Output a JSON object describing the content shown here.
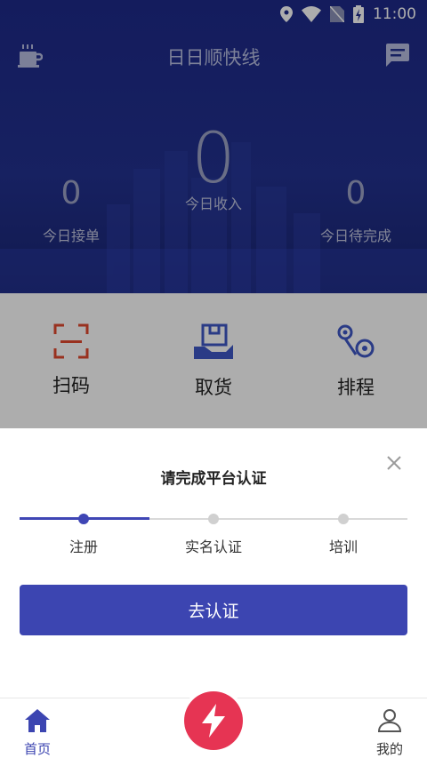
{
  "status_bar": {
    "time": "11:00"
  },
  "header": {
    "title": "日日顺快线"
  },
  "stats": {
    "main_value": "0",
    "items": [
      {
        "value": "0",
        "label": "今日接单"
      },
      {
        "value": "",
        "label": "今日收入"
      },
      {
        "value": "0",
        "label": "今日待完成"
      }
    ]
  },
  "actions": [
    {
      "label": "扫码",
      "icon": "scan-icon"
    },
    {
      "label": "取货",
      "icon": "pickup-icon"
    },
    {
      "label": "排程",
      "icon": "schedule-route-icon"
    }
  ],
  "sheet": {
    "title": "请完成平台认证",
    "steps": [
      {
        "label": "注册",
        "done": true
      },
      {
        "label": "实名认证",
        "done": false
      },
      {
        "label": "培训",
        "done": false
      }
    ],
    "button_label": "去认证"
  },
  "bottom_nav": {
    "home_label": "首页",
    "mine_label": "我的"
  },
  "colors": {
    "primary": "#3c45b1",
    "hero_bg": "#1e2a8a",
    "accent_red": "#e63453",
    "action_red": "#e2492f",
    "action_blue": "#3f57c6"
  }
}
